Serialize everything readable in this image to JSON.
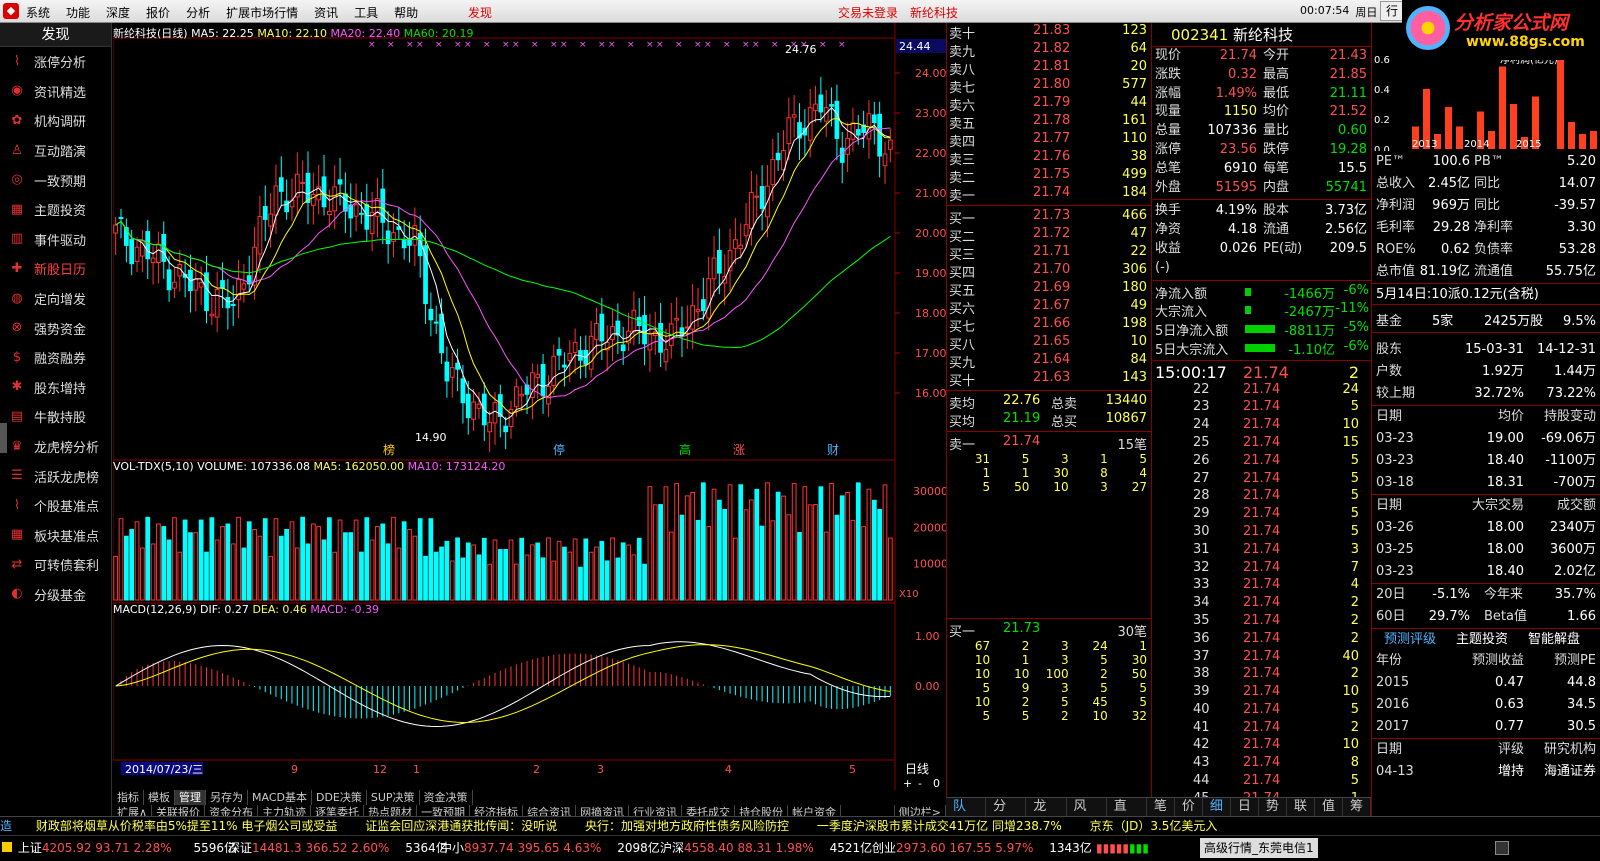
{
  "menu": {
    "items": [
      "系统",
      "功能",
      "深度",
      "报价",
      "分析",
      "扩展市场行情",
      "资讯",
      "工具",
      "帮助"
    ],
    "alert": "发现",
    "login": "交易未登录",
    "stock": "新纶科技",
    "time": "00:07:54",
    "weekday": "周日",
    "trade": "行"
  },
  "brand": {
    "title": "分析家公式网",
    "url": "www.88gs.com"
  },
  "sidebar": {
    "title": "发现",
    "items": [
      "涨停分析",
      "资讯精选",
      "机构调研",
      "互动踏演",
      "一致预期",
      "主题投资",
      "事件驱动",
      "新股日历",
      "定向增发",
      "强势资金",
      "融资融券",
      "股东增持",
      "牛散持股",
      "龙虎榜分析",
      "活跃龙虎榜",
      "个股基准点",
      "板块基准点",
      "可转债套利",
      "分级基金"
    ]
  },
  "chart": {
    "header": {
      "name": "新纶科技(日线)",
      "ma5": "MA5: 22.25",
      "ma10": "MA10: 22.10",
      "ma20": "MA20: 22.40",
      "ma60": "MA60: 20.19"
    },
    "price_axis": [
      "24.00",
      "23.00",
      "22.00",
      "21.00",
      "20.00",
      "19.00",
      "18.00",
      "17.00",
      "16.00"
    ],
    "price_current": "24.44",
    "high_label": "24.76",
    "low_label": "14.90",
    "events": [
      "榜",
      "停",
      "高",
      "涨",
      "财"
    ],
    "vol_header": {
      "name": "VOL-TDX(5,10)",
      "volume": "VOLUME: 107336.08",
      "ma5": "MA5: 162050.00",
      "ma10": "MA10: 173124.20"
    },
    "vol_axis": [
      "30000",
      "20000",
      "10000"
    ],
    "vol_unit": "X10",
    "macd_header": {
      "name": "MACD(12,26,9)",
      "dif": "DIF: 0.27",
      "dea": "DEA: 0.46",
      "macd": "MACD: -0.39"
    },
    "macd_axis": [
      "1.00",
      "0.00"
    ],
    "date_axis": [
      "2014/07/23/三",
      "9",
      "12",
      "1",
      "2",
      "3",
      "4",
      "5"
    ],
    "period": "日线",
    "tabs1": [
      "指标",
      "模板",
      "管理",
      "另存为",
      "MACD基本",
      "DDE决策",
      "SUP决策",
      "资金决策"
    ],
    "tabs2": [
      "扩展∧",
      "关联报价",
      "资金分布",
      "主力轨迹",
      "逐笔委托",
      "热点题材",
      "一致预期",
      "经济指标",
      "综合资讯",
      "网摘资讯",
      "行业资讯",
      "委托成交",
      "持仓股份",
      "帐户资金"
    ],
    "side_tab": "侧边栏>",
    "zoom": [
      "+",
      "-",
      "0"
    ]
  },
  "orderbook": {
    "asks": [
      [
        "卖十",
        "21.83",
        "123"
      ],
      [
        "卖九",
        "21.82",
        "64"
      ],
      [
        "卖八",
        "21.81",
        "20"
      ],
      [
        "卖七",
        "21.80",
        "577"
      ],
      [
        "卖六",
        "21.79",
        "44"
      ],
      [
        "卖五",
        "21.78",
        "161"
      ],
      [
        "卖四",
        "21.77",
        "110"
      ],
      [
        "卖三",
        "21.76",
        "38"
      ],
      [
        "卖二",
        "21.75",
        "499"
      ],
      [
        "卖一",
        "21.74",
        "184"
      ]
    ],
    "bids": [
      [
        "买一",
        "21.73",
        "466"
      ],
      [
        "买二",
        "21.72",
        "47"
      ],
      [
        "买三",
        "21.71",
        "22"
      ],
      [
        "买四",
        "21.70",
        "306"
      ],
      [
        "买五",
        "21.69",
        "180"
      ],
      [
        "买六",
        "21.67",
        "49"
      ],
      [
        "买七",
        "21.66",
        "198"
      ],
      [
        "买八",
        "21.65",
        "10"
      ],
      [
        "买九",
        "21.64",
        "84"
      ],
      [
        "买十",
        "21.63",
        "143"
      ]
    ],
    "avg_ask": [
      "卖均",
      "22.76",
      "总卖",
      "13440"
    ],
    "avg_bid": [
      "买均",
      "21.19",
      "总买",
      "10867"
    ],
    "sell1_queue": {
      "label": "卖一",
      "price": "21.74",
      "count": "15笔",
      "orders": [
        "31",
        "5",
        "3",
        "1",
        "5",
        "1",
        "1",
        "30",
        "8",
        "4",
        "5",
        "50",
        "10",
        "3",
        "27"
      ]
    },
    "buy1_queue": {
      "label": "买一",
      "price": "21.73",
      "count": "30笔",
      "orders": [
        "67",
        "2",
        "3",
        "24",
        "1",
        "10",
        "1",
        "3",
        "5",
        "30",
        "10",
        "10",
        "100",
        "2",
        "50",
        "5",
        "9",
        "3",
        "5",
        "5",
        "10",
        "2",
        "5",
        "45",
        "5",
        "5",
        "5",
        "2",
        "10",
        "32"
      ]
    }
  },
  "quote": {
    "code": "002341",
    "name": "新纶科技",
    "rows": [
      [
        "现价",
        "21.74",
        "今开",
        "21.43"
      ],
      [
        "涨跌",
        "0.32",
        "最高",
        "21.85"
      ],
      [
        "涨幅",
        "1.49%",
        "最低",
        "21.11"
      ],
      [
        "现量",
        "1150",
        "均价",
        "21.52"
      ],
      [
        "总量",
        "107336",
        "量比",
        "0.60"
      ],
      [
        "涨停",
        "23.56",
        "跌停",
        "19.28"
      ],
      [
        "总笔",
        "6910",
        "每笔",
        "15.5"
      ],
      [
        "外盘",
        "51595",
        "内盘",
        "55741"
      ]
    ],
    "rows2": [
      [
        "换手",
        "4.19%",
        "股本",
        "3.73亿"
      ],
      [
        "净资",
        "4.18",
        "流通",
        "2.56亿"
      ],
      [
        "收益(-)",
        "0.026",
        "PE(动)",
        "209.5"
      ]
    ],
    "flows": [
      [
        "净流入额",
        "-1466万",
        "-6%"
      ],
      [
        "大宗流入",
        "-2467万",
        "-11%"
      ],
      [
        "5日净流入额",
        "-8811万",
        "-5%"
      ],
      [
        "5日大宗流入",
        "-1.10亿",
        "-6%"
      ]
    ],
    "ticks_time": "15:00:17",
    "ticks": [
      [
        "22",
        "21.74",
        "24"
      ],
      [
        "23",
        "21.74",
        "5"
      ],
      [
        "24",
        "21.74",
        "10"
      ],
      [
        "25",
        "21.74",
        "15"
      ],
      [
        "26",
        "21.74",
        "5"
      ],
      [
        "27",
        "21.74",
        "5"
      ],
      [
        "28",
        "21.74",
        "5"
      ],
      [
        "29",
        "21.74",
        "5"
      ],
      [
        "30",
        "21.74",
        "5"
      ],
      [
        "31",
        "21.74",
        "3"
      ],
      [
        "32",
        "21.74",
        "7"
      ],
      [
        "33",
        "21.74",
        "4"
      ],
      [
        "34",
        "21.74",
        "2"
      ],
      [
        "35",
        "21.74",
        "2"
      ],
      [
        "36",
        "21.74",
        "2"
      ],
      [
        "37",
        "21.74",
        "40"
      ],
      [
        "38",
        "21.74",
        "2"
      ],
      [
        "39",
        "21.74",
        "10"
      ],
      [
        "40",
        "21.74",
        "5"
      ],
      [
        "41",
        "21.74",
        "2"
      ],
      [
        "42",
        "21.74",
        "10"
      ],
      [
        "43",
        "21.74",
        "8"
      ],
      [
        "44",
        "21.74",
        "5"
      ],
      [
        "45",
        "21.74",
        "1"
      ]
    ],
    "first_tick": [
      "",
      "21.74",
      "2"
    ]
  },
  "bottom_tabs": [
    "队列",
    "分布",
    "龙虎",
    "风向",
    "直播",
    "笔",
    "价",
    "细",
    "日",
    "势",
    "联",
    "值",
    "筹"
  ],
  "f10": {
    "chart_title": "净利润(亿元)",
    "years": [
      "2013",
      "2014",
      "2015"
    ],
    "axis": [
      "0.6",
      "0.4",
      "0.2",
      "0.0"
    ],
    "rows": [
      [
        "PE™",
        "100.6",
        "PB™",
        "5.20"
      ],
      [
        "总收入",
        "2.45亿",
        "同比",
        "14.07"
      ],
      [
        "净利润",
        "969万",
        "同比",
        "-39.57"
      ],
      [
        "毛利率",
        "29.28",
        "净利率",
        "3.30"
      ],
      [
        "ROE%",
        "0.62",
        "负债率",
        "53.28"
      ],
      [
        "总市值",
        "81.19亿",
        "流通值",
        "55.75亿"
      ]
    ],
    "dividend": "5月14日:10派0.12元(含税)",
    "fund": [
      "基金",
      "5家",
      "2425万股",
      "9.5%"
    ],
    "holders": [
      [
        "股东",
        "15-03-31",
        "14-12-31"
      ],
      [
        "户数",
        "1.92万",
        "1.44万"
      ],
      [
        "较上期",
        "32.72%",
        "73.22%"
      ]
    ],
    "change_hdr": [
      "日期",
      "均价",
      "持股变动"
    ],
    "changes": [
      [
        "03-23",
        "19.00",
        "-69.06万"
      ],
      [
        "03-23",
        "18.40",
        "-1100万"
      ],
      [
        "03-18",
        "18.31",
        "-700万"
      ]
    ],
    "block_hdr": [
      "日期",
      "大宗交易",
      "成交额"
    ],
    "blocks": [
      [
        "03-26",
        "18.00",
        "2340万"
      ],
      [
        "03-25",
        "18.00",
        "3600万"
      ],
      [
        "03-23",
        "18.40",
        "2.02亿"
      ]
    ],
    "perf": [
      [
        "20日",
        "-5.1%",
        "今年来",
        "35.7%"
      ],
      [
        "60日",
        "29.7%",
        "Beta值",
        "1.66"
      ]
    ],
    "tabs": [
      "预测评级",
      "主题投资",
      "智能解盘"
    ],
    "fc_hdr": [
      "年份",
      "预测收益",
      "预测PE"
    ],
    "forecasts": [
      [
        "2015",
        "0.47",
        "44.8"
      ],
      [
        "2016",
        "0.63",
        "34.5"
      ],
      [
        "2017",
        "0.77",
        "30.5"
      ]
    ],
    "rating_hdr": [
      "日期",
      "评级",
      "研究机构"
    ],
    "rating": [
      "04-13",
      "增持",
      "海通证券"
    ]
  },
  "ticker": [
    "财政部将烟草从价税率由5%提至11% 电子烟公司或受益",
    "证监会回应深港通获批传闻：没听说",
    "央行：加强对地方政府性债务风险防控",
    "一季度沪深股市累计成交41万亿 同增238.7%",
    "京东（JD）3.5亿美元入"
  ],
  "status": {
    "sh": [
      "上证",
      "4205.92",
      "93.71",
      "2.28%",
      "5596亿"
    ],
    "sz": [
      "深证",
      "14481.3",
      "366.52",
      "2.60%",
      "5364亿"
    ],
    "zx": [
      "中小",
      "8937.74",
      "395.65",
      "4.63%",
      "2098亿"
    ],
    "hs": [
      "沪深",
      "4558.40",
      "88.31",
      "1.98%",
      "4521亿"
    ],
    "cy": [
      "创业",
      "2973.60",
      "167.55",
      "5.97%",
      "1343亿"
    ],
    "server": "高级行情_东莞电信1"
  },
  "colors": {
    "up": "#ff3030",
    "down": "#00ffff",
    "ma5": "#ffffff",
    "ma10": "#ffff00",
    "ma20": "#ff55ff",
    "ma60": "#00ff00"
  }
}
